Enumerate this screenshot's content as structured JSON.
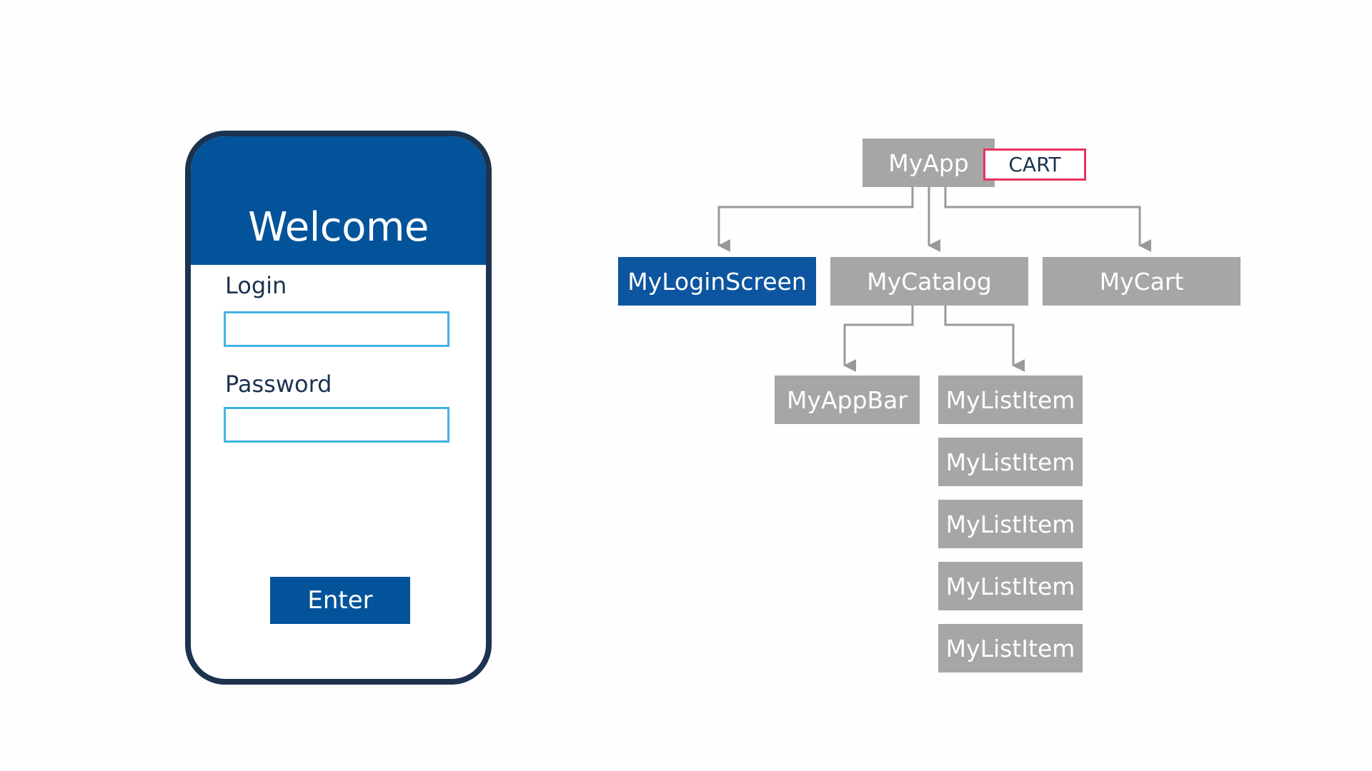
{
  "phone": {
    "header_title": "Welcome",
    "login_label": "Login",
    "login_value": "",
    "password_label": "Password",
    "password_value": "",
    "enter_button": "Enter"
  },
  "tree": {
    "root": {
      "label": "MyApp",
      "badge": "CART"
    },
    "level1": [
      {
        "label": "MyLoginScreen",
        "state": "active"
      },
      {
        "label": "MyCatalog",
        "state": "default"
      },
      {
        "label": "MyCart",
        "state": "default"
      }
    ],
    "catalog_children": [
      {
        "label": "MyAppBar"
      },
      {
        "label": "MyListItem"
      }
    ],
    "list_items": [
      "MyListItem",
      "MyListItem",
      "MyListItem",
      "MyListItem",
      "MyListItem"
    ]
  },
  "colors": {
    "primary_blue": "#03539a",
    "node_gray": "#a6a6a6",
    "frame_navy": "#1c3350",
    "input_border": "#3fb4e4",
    "highlight_pink": "#e8335f",
    "connector_gray": "#999999"
  }
}
